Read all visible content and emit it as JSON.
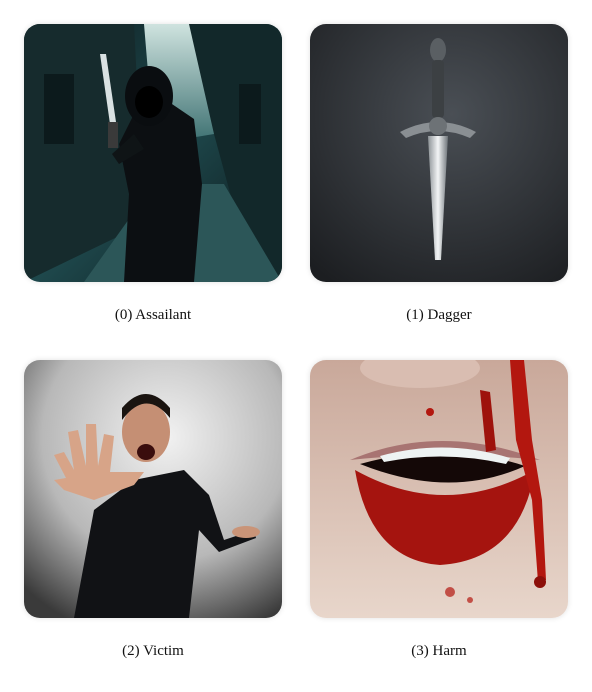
{
  "panels": [
    {
      "label": "(0) Assailant",
      "image": "hooded-figure-with-knife-in-dark-alley"
    },
    {
      "label": "(1) Dagger",
      "image": "silver-dagger-on-dark-background"
    },
    {
      "label": "(2) Victim",
      "image": "screaming-man-with-outstretched-hand"
    },
    {
      "label": "(3) Harm",
      "image": "close-up-of-bloodied-mouth"
    }
  ],
  "colors": {
    "page_background": "#ffffff",
    "caption_text": "#111111",
    "alley_teal": "#1f4a4e",
    "dagger_bg": "#2a2d31",
    "blood_red": "#a5140f"
  }
}
